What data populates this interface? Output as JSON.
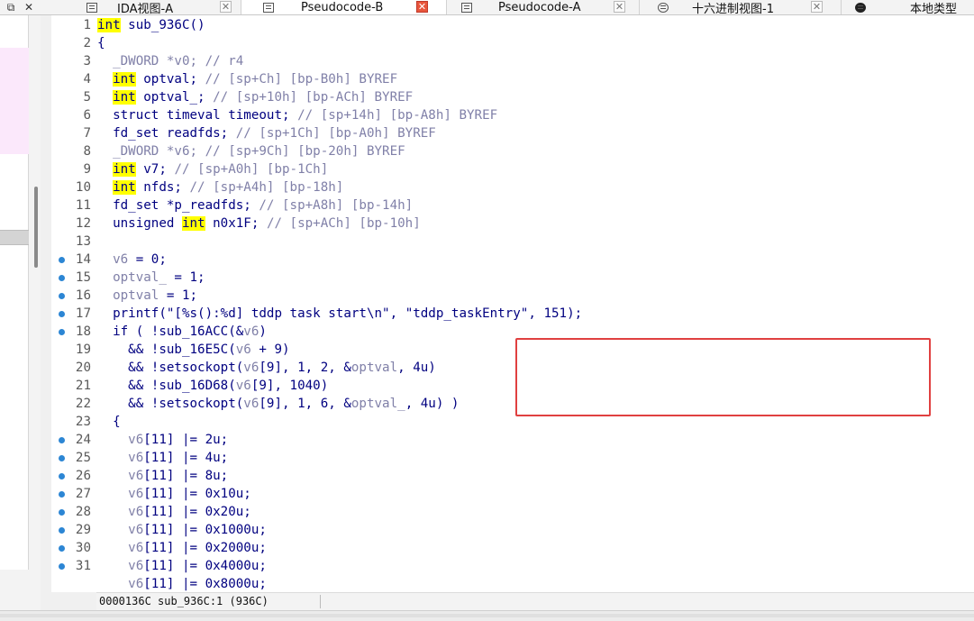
{
  "tabs": [
    {
      "label": "IDA视图-A",
      "active": false,
      "icon": "listing-icon"
    },
    {
      "label": "Pseudocode-B",
      "active": true,
      "icon": "listing-icon"
    },
    {
      "label": "Pseudocode-A",
      "active": false,
      "icon": "listing-icon"
    },
    {
      "label": "十六进制视图-1",
      "active": false,
      "icon": "hex-view-icon"
    },
    {
      "label": "本地类型",
      "active": false,
      "icon": "info-icon"
    }
  ],
  "window_controls": {
    "restore": "⧉",
    "close": "✕"
  },
  "close_glyph": "✕",
  "code_lines": [
    {
      "n": "1",
      "dot": false,
      "tokens": [
        {
          "t": "int",
          "c": "hl"
        },
        {
          "t": " sub_936C()",
          "c": "k"
        }
      ]
    },
    {
      "n": "2",
      "dot": false,
      "tokens": [
        {
          "t": "{",
          "c": "k"
        }
      ]
    },
    {
      "n": "3",
      "dot": false,
      "tokens": [
        {
          "t": "  _DWORD *v0; ",
          "c": "v"
        },
        {
          "t": "// r4",
          "c": "c"
        }
      ]
    },
    {
      "n": "4",
      "dot": false,
      "tokens": [
        {
          "t": "  ",
          "c": "k"
        },
        {
          "t": "int",
          "c": "hl"
        },
        {
          "t": " optval; ",
          "c": "k"
        },
        {
          "t": "// [sp+Ch] [bp-B0h] BYREF",
          "c": "c"
        }
      ]
    },
    {
      "n": "5",
      "dot": false,
      "tokens": [
        {
          "t": "  ",
          "c": "k"
        },
        {
          "t": "int",
          "c": "hl"
        },
        {
          "t": " optval_; ",
          "c": "k"
        },
        {
          "t": "// [sp+10h] [bp-ACh] BYREF",
          "c": "c"
        }
      ]
    },
    {
      "n": "6",
      "dot": false,
      "tokens": [
        {
          "t": "  struct timeval timeout; ",
          "c": "k"
        },
        {
          "t": "// [sp+14h] [bp-A8h] BYREF",
          "c": "c"
        }
      ]
    },
    {
      "n": "7",
      "dot": false,
      "tokens": [
        {
          "t": "  fd_set readfds; ",
          "c": "k"
        },
        {
          "t": "// [sp+1Ch] [bp-A0h] BYREF",
          "c": "c"
        }
      ]
    },
    {
      "n": "8",
      "dot": false,
      "tokens": [
        {
          "t": "  _DWORD *v6; ",
          "c": "v"
        },
        {
          "t": "// [sp+9Ch] [bp-20h] BYREF",
          "c": "c"
        }
      ]
    },
    {
      "n": "9",
      "dot": false,
      "tokens": [
        {
          "t": "  ",
          "c": "k"
        },
        {
          "t": "int",
          "c": "hl"
        },
        {
          "t": " v7; ",
          "c": "k"
        },
        {
          "t": "// [sp+A0h] [bp-1Ch]",
          "c": "c"
        }
      ]
    },
    {
      "n": "10",
      "dot": false,
      "tokens": [
        {
          "t": "  ",
          "c": "k"
        },
        {
          "t": "int",
          "c": "hl"
        },
        {
          "t": " nfds; ",
          "c": "k"
        },
        {
          "t": "// [sp+A4h] [bp-18h]",
          "c": "c"
        }
      ]
    },
    {
      "n": "11",
      "dot": false,
      "tokens": [
        {
          "t": "  fd_set *p_readfds; ",
          "c": "k"
        },
        {
          "t": "// [sp+A8h] [bp-14h]",
          "c": "c"
        }
      ]
    },
    {
      "n": "12",
      "dot": false,
      "tokens": [
        {
          "t": "  unsigned ",
          "c": "k"
        },
        {
          "t": "int",
          "c": "hl"
        },
        {
          "t": " n0x1F; ",
          "c": "k"
        },
        {
          "t": "// [sp+ACh] [bp-10h]",
          "c": "c"
        }
      ]
    },
    {
      "n": "13",
      "dot": false,
      "tokens": []
    },
    {
      "n": "14",
      "dot": true,
      "tokens": [
        {
          "t": "  v6",
          "c": "v"
        },
        {
          "t": " = 0;",
          "c": "k"
        }
      ]
    },
    {
      "n": "15",
      "dot": true,
      "tokens": [
        {
          "t": "  optval_",
          "c": "v"
        },
        {
          "t": " = 1;",
          "c": "k"
        }
      ]
    },
    {
      "n": "16",
      "dot": true,
      "tokens": [
        {
          "t": "  optval",
          "c": "v"
        },
        {
          "t": " = 1;",
          "c": "k"
        }
      ]
    },
    {
      "n": "17",
      "dot": true,
      "tokens": [
        {
          "t": "  printf(",
          "c": "k"
        },
        {
          "t": "\"[%s():%d] tddp task start\\n\"",
          "c": "s"
        },
        {
          "t": ", ",
          "c": "k"
        },
        {
          "t": "\"tddp_taskEntry\"",
          "c": "s"
        },
        {
          "t": ", 151);",
          "c": "k"
        }
      ]
    },
    {
      "n": "18",
      "dot": true,
      "tokens": [
        {
          "t": "  if ( !sub_16ACC(&",
          "c": "k"
        },
        {
          "t": "v6",
          "c": "v"
        },
        {
          "t": ")",
          "c": "k"
        }
      ]
    },
    {
      "n": "19",
      "dot": false,
      "tokens": [
        {
          "t": "    && !sub_16E5C(",
          "c": "k"
        },
        {
          "t": "v6",
          "c": "v"
        },
        {
          "t": " + 9)",
          "c": "k"
        }
      ]
    },
    {
      "n": "20",
      "dot": false,
      "tokens": [
        {
          "t": "    && !setsockopt(",
          "c": "k"
        },
        {
          "t": "v6",
          "c": "v"
        },
        {
          "t": "[9], 1, 2, &",
          "c": "k"
        },
        {
          "t": "optval",
          "c": "v"
        },
        {
          "t": ", 4u)",
          "c": "k"
        }
      ]
    },
    {
      "n": "21",
      "dot": false,
      "tokens": [
        {
          "t": "    && !sub_16D68(",
          "c": "k"
        },
        {
          "t": "v6",
          "c": "v"
        },
        {
          "t": "[9], 1040)",
          "c": "k"
        }
      ]
    },
    {
      "n": "22",
      "dot": false,
      "tokens": [
        {
          "t": "    && !setsockopt(",
          "c": "k"
        },
        {
          "t": "v6",
          "c": "v"
        },
        {
          "t": "[9], 1, 6, &",
          "c": "k"
        },
        {
          "t": "optval_",
          "c": "v"
        },
        {
          "t": ", 4u) )",
          "c": "k"
        }
      ]
    },
    {
      "n": "23",
      "dot": false,
      "tokens": [
        {
          "t": "  {",
          "c": "k"
        }
      ]
    },
    {
      "n": "24",
      "dot": true,
      "tokens": [
        {
          "t": "    v6",
          "c": "v"
        },
        {
          "t": "[11] |= 2u;",
          "c": "k"
        }
      ]
    },
    {
      "n": "25",
      "dot": true,
      "tokens": [
        {
          "t": "    v6",
          "c": "v"
        },
        {
          "t": "[11] |= 4u;",
          "c": "k"
        }
      ]
    },
    {
      "n": "26",
      "dot": true,
      "tokens": [
        {
          "t": "    v6",
          "c": "v"
        },
        {
          "t": "[11] |= 8u;",
          "c": "k"
        }
      ]
    },
    {
      "n": "27",
      "dot": true,
      "tokens": [
        {
          "t": "    v6",
          "c": "v"
        },
        {
          "t": "[11] |= 0x10u;",
          "c": "k"
        }
      ]
    },
    {
      "n": "28",
      "dot": true,
      "tokens": [
        {
          "t": "    v6",
          "c": "v"
        },
        {
          "t": "[11] |= 0x20u;",
          "c": "k"
        }
      ]
    },
    {
      "n": "29",
      "dot": true,
      "tokens": [
        {
          "t": "    v6",
          "c": "v"
        },
        {
          "t": "[11] |= 0x1000u;",
          "c": "k"
        }
      ]
    },
    {
      "n": "30",
      "dot": true,
      "tokens": [
        {
          "t": "    v6",
          "c": "v"
        },
        {
          "t": "[11] |= 0x2000u;",
          "c": "k"
        }
      ]
    },
    {
      "n": "31",
      "dot": true,
      "tokens": [
        {
          "t": "    v6",
          "c": "v"
        },
        {
          "t": "[11] |= 0x4000u;",
          "c": "k"
        }
      ]
    },
    {
      "n": "",
      "dot": false,
      "tokens": [
        {
          "t": "    v6",
          "c": "v"
        },
        {
          "t": "[11] |= 0x8000u;",
          "c": "k"
        }
      ]
    }
  ],
  "statusbar": {
    "text": "0000136C sub_936C:1 (936C)"
  },
  "colors": {
    "highlight": "#ffff00",
    "annotation_box": "#e04040",
    "breakpoint_dot": "#2c86d4",
    "active_tab_close": "#e8553b"
  }
}
